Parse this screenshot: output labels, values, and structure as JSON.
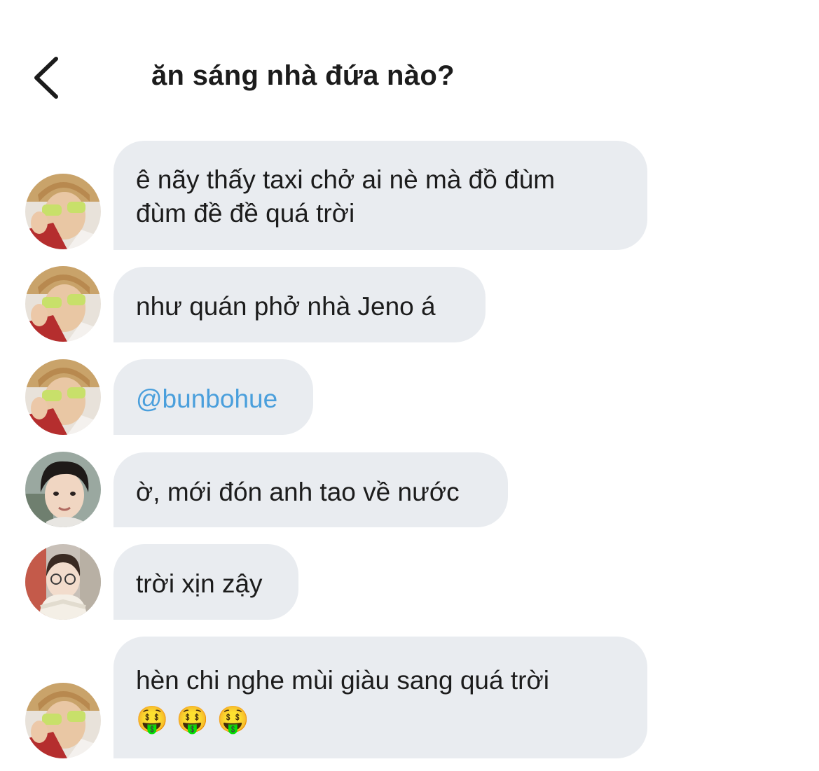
{
  "header": {
    "title": "ăn sáng nhà đứa nào?",
    "back_icon": "chevron-left-icon"
  },
  "colors": {
    "bubble_bg": "#e9ecf0",
    "mention": "#4a9fdc",
    "text": "#1c1c1c"
  },
  "messages": [
    {
      "avatar_icon": "avatar-photo",
      "lines": [
        "ê nãy thấy taxi chở ai nè mà đồ đùm",
        "đùm đề đề quá trời"
      ]
    },
    {
      "avatar_icon": "avatar-photo",
      "lines": [
        "như quán phở nhà Jeno á"
      ]
    },
    {
      "avatar_icon": "avatar-photo",
      "lines": [
        "@bunbohue"
      ]
    },
    {
      "avatar_icon": "avatar-photo",
      "lines": [
        "ờ, mới đón anh tao về nước"
      ]
    },
    {
      "avatar_icon": "avatar-photo",
      "lines": [
        "trời xịn zậy"
      ]
    },
    {
      "avatar_icon": "avatar-photo",
      "lines": [
        "hèn chi nghe mùi giàu sang quá trời",
        "🤑 🤑 🤑"
      ]
    }
  ]
}
